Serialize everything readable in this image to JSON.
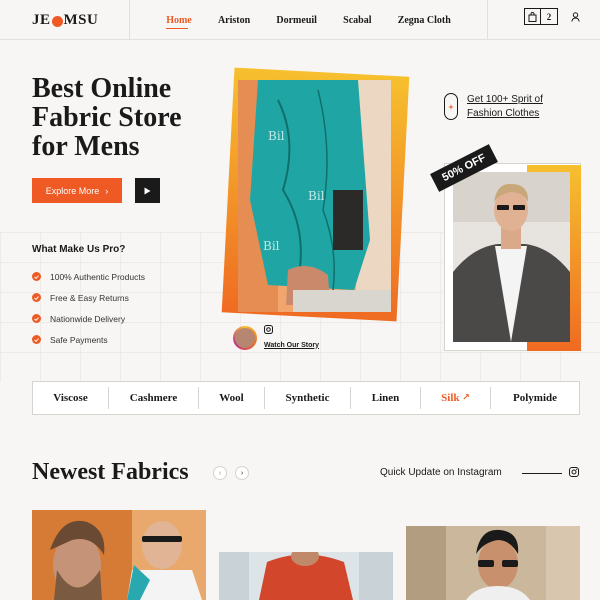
{
  "brand": {
    "logo_left": "JE",
    "logo_right": "MSU"
  },
  "nav": [
    {
      "label": "Home",
      "active": true
    },
    {
      "label": "Ariston",
      "active": false
    },
    {
      "label": "Dormeuil",
      "active": false
    },
    {
      "label": "Scabal",
      "active": false
    },
    {
      "label": "Zegna Cloth",
      "active": false
    }
  ],
  "header": {
    "bag_count": "2",
    "icons": [
      "bag-icon",
      "user-icon"
    ]
  },
  "hero": {
    "title_line1": "Best Online",
    "title_line2": "Fabric Store",
    "title_line3": "for Mens",
    "explore_label": "Explore More",
    "explore_arrow": "›"
  },
  "pro": {
    "title": "What Make Us Pro?",
    "items": [
      "100% Authentic Products",
      "Free & Easy Returns",
      "Nationwide Delivery",
      "Safe Payments"
    ]
  },
  "promo": {
    "get_more_line1": "Get 100+ Sprit of",
    "get_more_line2": "Fashion Clothes",
    "badge": "50% OFF"
  },
  "story": {
    "label": "Watch Our Story"
  },
  "fabrics": [
    {
      "label": "Viscose",
      "active": false
    },
    {
      "label": "Cashmere",
      "active": false
    },
    {
      "label": "Wool",
      "active": false
    },
    {
      "label": "Synthetic",
      "active": false
    },
    {
      "label": "Linen",
      "active": false
    },
    {
      "label": "Silk",
      "active": true,
      "arrow": "↗"
    },
    {
      "label": "Polymide",
      "active": false
    }
  ],
  "newest": {
    "title": "Newest Fabrics",
    "prev": "‹",
    "next": "›",
    "quick_update": "Quick Update on Instagram"
  },
  "colors": {
    "accent": "#ef5a24",
    "accent_light": "#f6c02e",
    "dark": "#1a1a1a",
    "bg": "#f7f6f4"
  }
}
